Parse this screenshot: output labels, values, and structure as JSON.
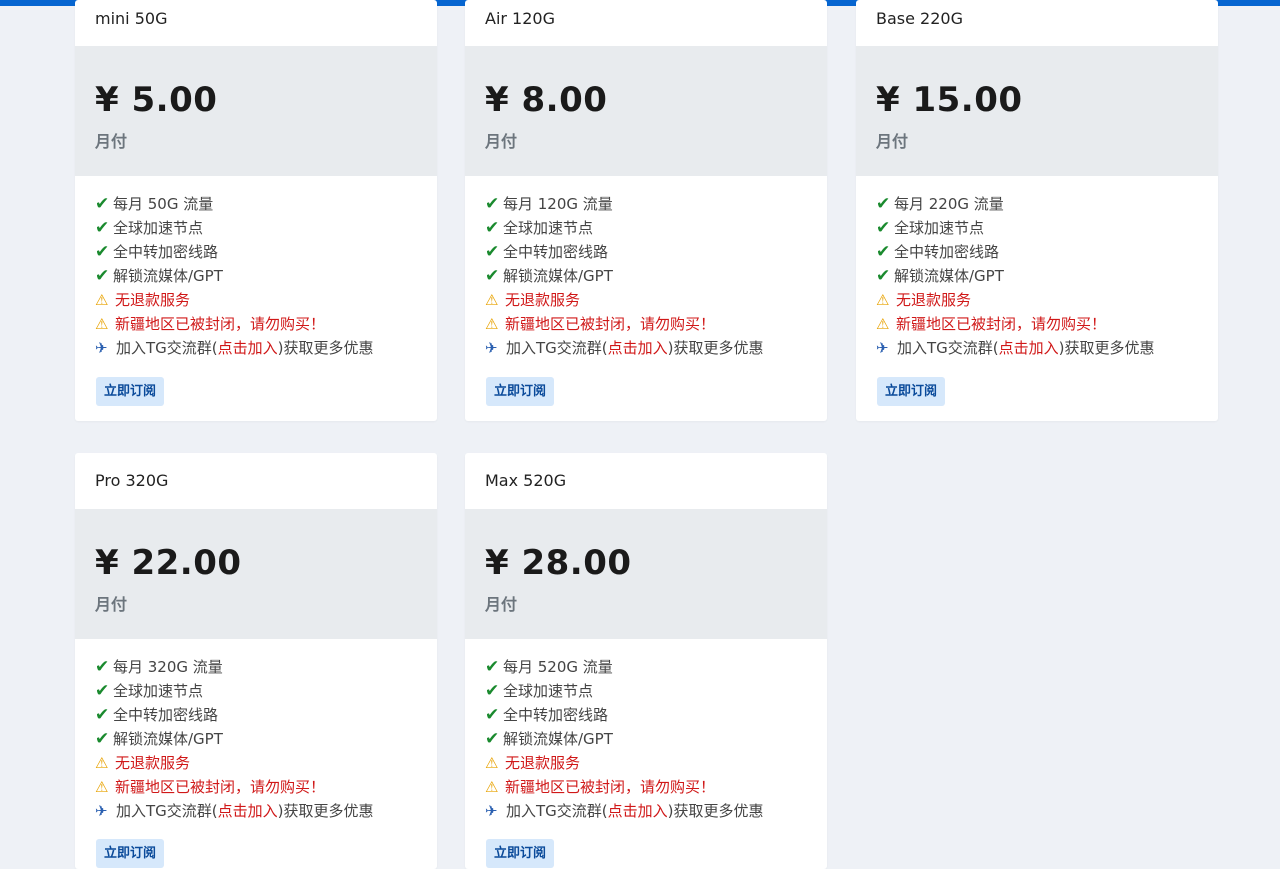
{
  "colors": {
    "accent_bar": "#0665d0",
    "background": "#eef1f6",
    "price_block": "#e8ebee",
    "check": "#1a8a2e",
    "warning_text": "#d01818",
    "button_bg": "#d6e8fb",
    "button_text": "#0a4a9a"
  },
  "icons": {
    "check": "✔",
    "warning": "⚠",
    "plane": "✈"
  },
  "plans": [
    {
      "name": "mini 50G",
      "price": "¥ 5.00",
      "period": "月付",
      "features": [
        "每月 50G 流量",
        "全球加速节点",
        "全中转加密线路",
        "解锁流媒体/GPT"
      ],
      "no_refund": "无退款服务",
      "xinjiang": "新疆地区已被封闭，请勿购买！",
      "tg_prefix": "加入TG交流群(",
      "tg_link": "点击加入",
      "tg_suffix": ")获取更多优惠",
      "button": "立即订阅"
    },
    {
      "name": "Air 120G",
      "price": "¥ 8.00",
      "period": "月付",
      "features": [
        "每月 120G 流量",
        "全球加速节点",
        "全中转加密线路",
        "解锁流媒体/GPT"
      ],
      "no_refund": "无退款服务",
      "xinjiang": "新疆地区已被封闭，请勿购买！",
      "tg_prefix": "加入TG交流群(",
      "tg_link": "点击加入",
      "tg_suffix": ")获取更多优惠",
      "button": "立即订阅"
    },
    {
      "name": "Base 220G",
      "price": "¥ 15.00",
      "period": "月付",
      "features": [
        "每月 220G 流量",
        "全球加速节点",
        "全中转加密线路",
        "解锁流媒体/GPT"
      ],
      "no_refund": "无退款服务",
      "xinjiang": "新疆地区已被封闭，请勿购买！",
      "tg_prefix": "加入TG交流群(",
      "tg_link": "点击加入",
      "tg_suffix": ")获取更多优惠",
      "button": "立即订阅"
    },
    {
      "name": "Pro 320G",
      "price": "¥ 22.00",
      "period": "月付",
      "features": [
        "每月 320G 流量",
        "全球加速节点",
        "全中转加密线路",
        "解锁流媒体/GPT"
      ],
      "no_refund": "无退款服务",
      "xinjiang": "新疆地区已被封闭，请勿购买！",
      "tg_prefix": "加入TG交流群(",
      "tg_link": "点击加入",
      "tg_suffix": ")获取更多优惠",
      "button": "立即订阅"
    },
    {
      "name": "Max 520G",
      "price": "¥ 28.00",
      "period": "月付",
      "features": [
        "每月 520G 流量",
        "全球加速节点",
        "全中转加密线路",
        "解锁流媒体/GPT"
      ],
      "no_refund": "无退款服务",
      "xinjiang": "新疆地区已被封闭，请勿购买！",
      "tg_prefix": "加入TG交流群(",
      "tg_link": "点击加入",
      "tg_suffix": ")获取更多优惠",
      "button": "立即订阅"
    }
  ]
}
